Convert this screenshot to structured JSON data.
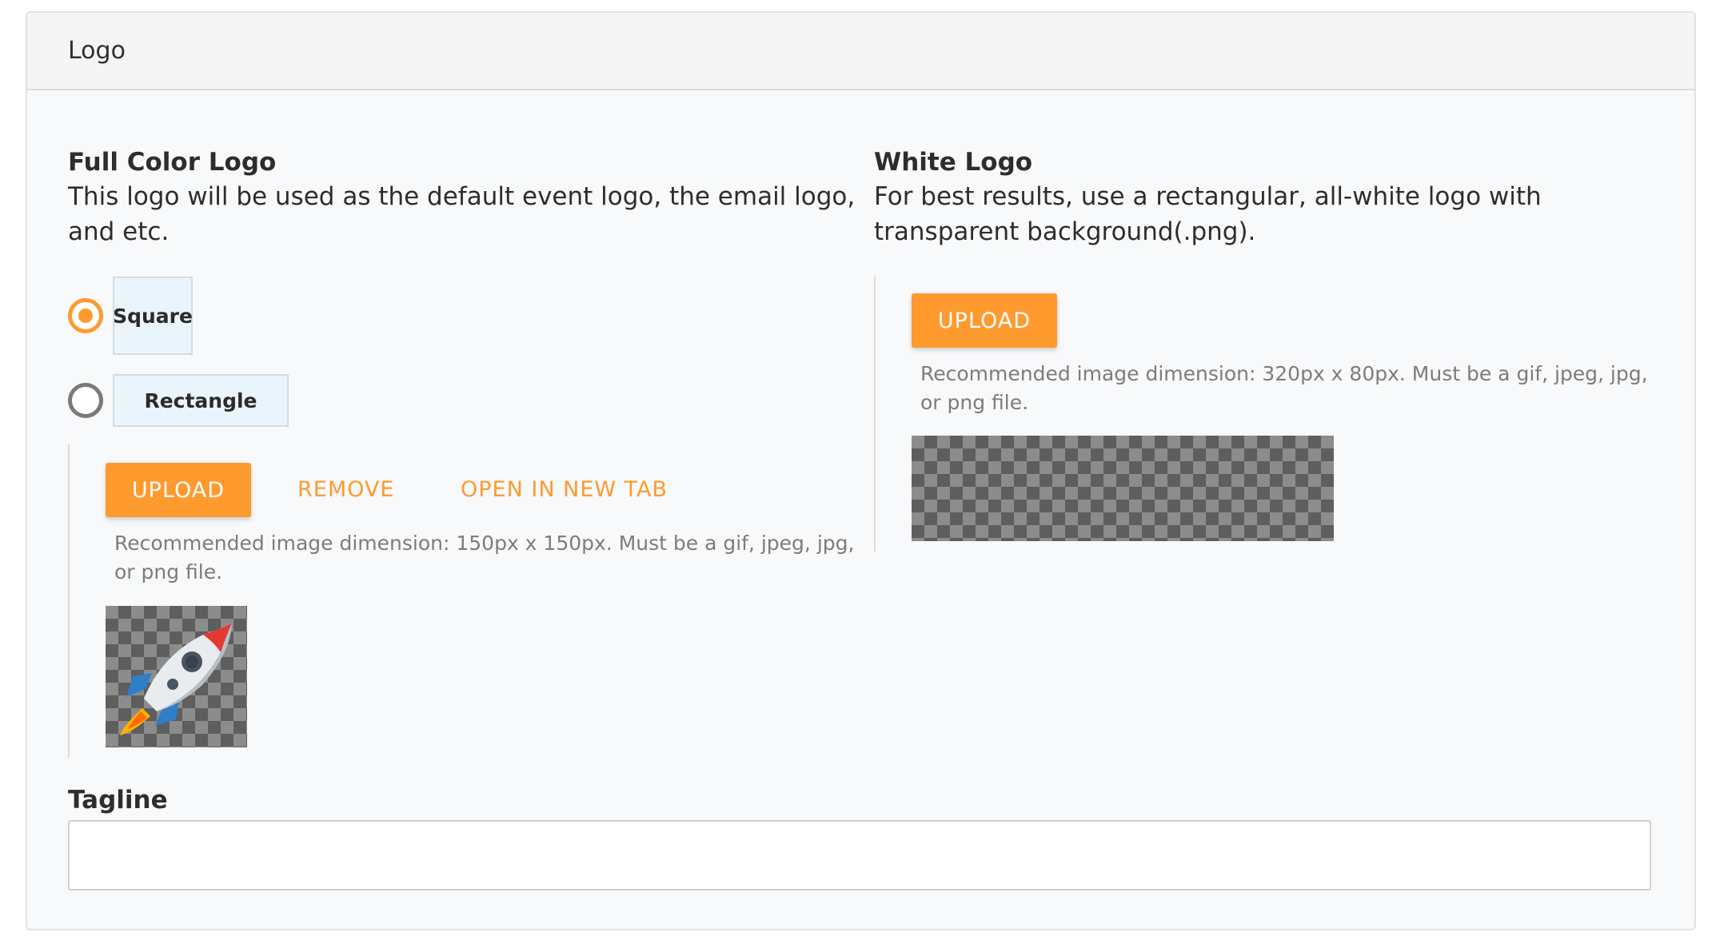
{
  "card": {
    "title": "Logo"
  },
  "full_color_logo": {
    "title": "Full Color Logo",
    "description": "This logo will be used as the default event logo, the email logo, and etc.",
    "shape_options": [
      {
        "label": "Square",
        "selected": true
      },
      {
        "label": "Rectangle",
        "selected": false
      }
    ],
    "upload_label": "UPLOAD",
    "remove_label": "REMOVE",
    "open_new_tab_label": "OPEN IN NEW TAB",
    "hint": "Recommended image dimension: 150px x 150px. Must be a gif, jpeg, jpg, or png file.",
    "preview_icon": "rocket-icon"
  },
  "white_logo": {
    "title": "White Logo",
    "description": "For best results, use a rectangular, all-white logo with transparent background(.png).",
    "upload_label": "UPLOAD",
    "hint": "Recommended image dimension: 320px x 80px. Must be a gif, jpeg, jpg, or png file."
  },
  "tagline": {
    "label": "Tagline",
    "value": "",
    "placeholder": ""
  },
  "colors": {
    "accent": "#ff9a2f",
    "card_background": "#f8f9fb",
    "header_background": "#f5f5f5",
    "shape_option_background": "#eaf4fb"
  }
}
